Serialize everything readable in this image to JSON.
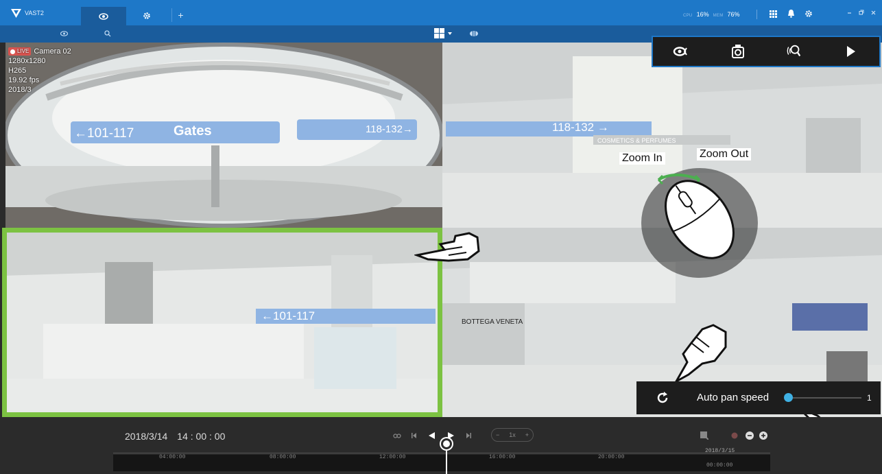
{
  "app": {
    "name": "VAST2"
  },
  "system": {
    "cpu_label": "CPU",
    "cpu_value": "16%",
    "mem_label": "MEM",
    "mem_value": "76%"
  },
  "tabs": [
    {
      "name": "liveview",
      "icon": "eye-icon",
      "active": true
    },
    {
      "name": "settings",
      "icon": "gear-icon",
      "active": false
    },
    {
      "name": "add",
      "label": "+"
    }
  ],
  "camera": {
    "live_label": "LIVE",
    "name": "Camera 02",
    "resolution": "1280x1280",
    "codec": "H265",
    "fps": "19.92 fps",
    "date_partial": "2018/3"
  },
  "scene_signs": {
    "gates_left": "←101-117",
    "gates_right": "118-132→",
    "gates_word": "Gates",
    "gates_pane3": "←101-117",
    "gates_pane2": "118-132 →",
    "cosmetics": "COSMETICS & PERFUMES",
    "bottega": "BOTTEGA VENETA"
  },
  "annotations": {
    "zoom_in": "Zoom In",
    "zoom_out": "Zoom Out"
  },
  "autopan": {
    "label": "Auto pan speed",
    "value": "1"
  },
  "playback": {
    "date": "2018/3/14",
    "time": "14 : 00 : 00",
    "speed_label": "1x",
    "speed_minus": "−",
    "speed_plus": "+"
  },
  "timeline": {
    "ticks": [
      "04:00:00",
      "08:00:00",
      "12:00:00",
      "16:00:00",
      "20:00:00",
      "00:00:00"
    ],
    "date_mark": "2018/3/15"
  },
  "colors": {
    "accent": "#1e78c8",
    "selection": "#7cc242",
    "live": "#d9534f",
    "slider": "#3fb1e4"
  }
}
